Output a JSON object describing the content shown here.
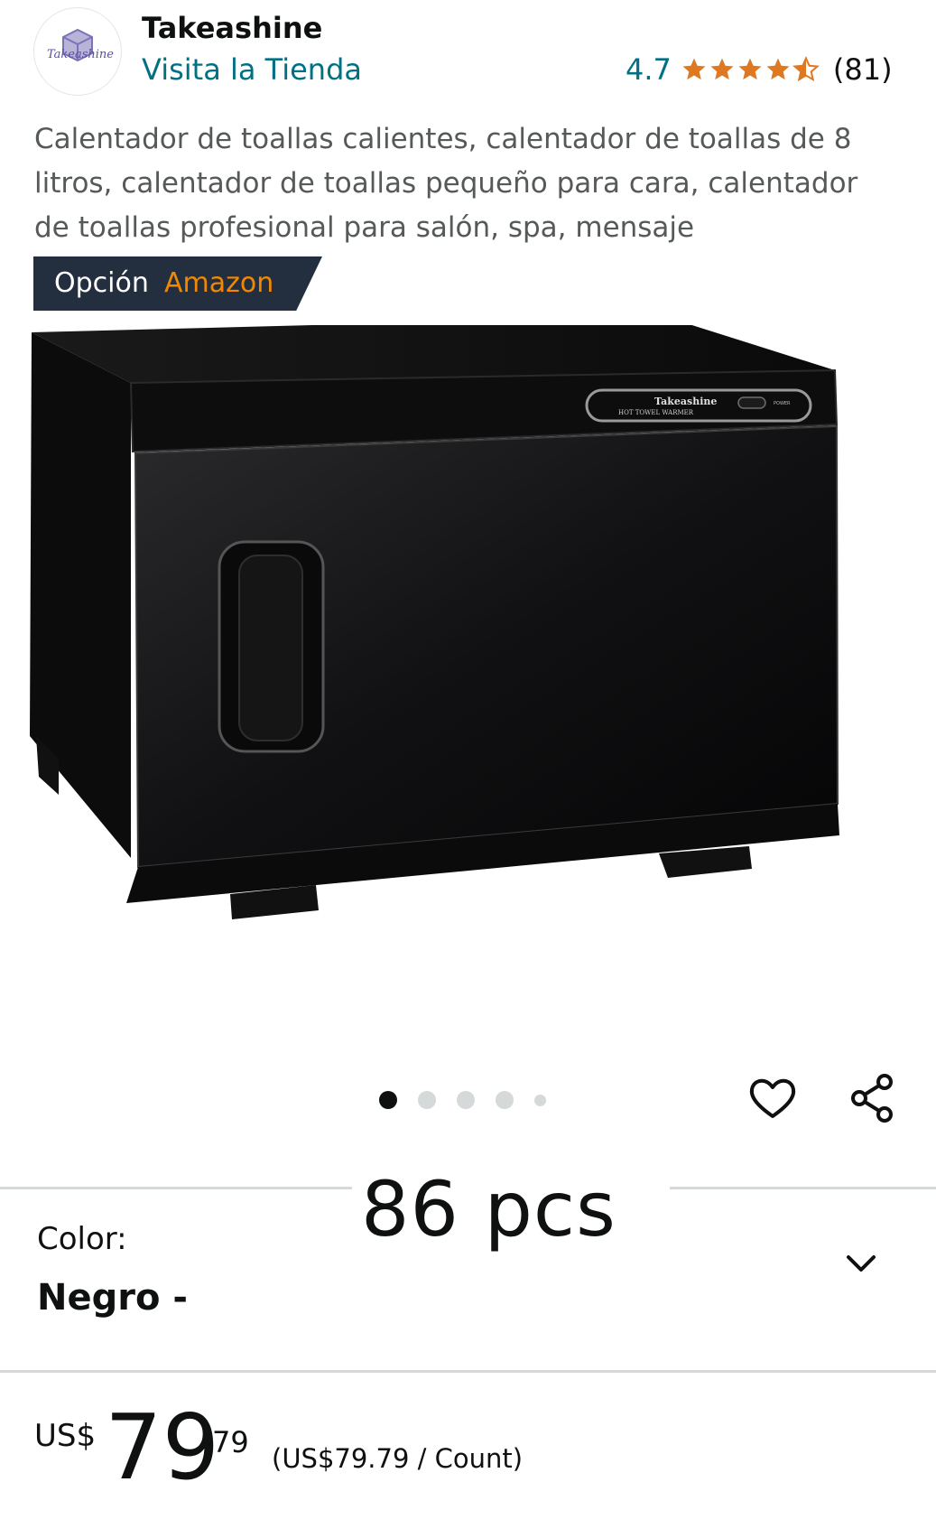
{
  "store": {
    "brand": "Takeashine",
    "logo_text": "Takeashine",
    "visit_link": "Visita la Tienda",
    "rating": "4.7",
    "stars": 4.7,
    "review_count": "(81)"
  },
  "product": {
    "title": "Calentador de toallas calientes, calentador de toallas de 8 litros, calentador de toallas pequeño para cara, calentador de toallas profesional para salón, spa, mensaje",
    "badge_prefix": "Opción",
    "badge_brand": "Amazon",
    "device_brand_label": "Takeashine",
    "device_model_label": "HOT TOWEL WARMER",
    "device_power_label": "POWER"
  },
  "carousel": {
    "total": 5,
    "active": 1
  },
  "overlay_text": "86 pcs",
  "variant": {
    "label": "Color:",
    "value": "Negro -"
  },
  "price": {
    "currency": "US$",
    "whole": "79",
    "fraction": "79",
    "unit_price": "(US$79.79 / Count)"
  },
  "colors": {
    "link": "#007185",
    "star": "#de7921",
    "badge_bg": "#232f3e",
    "badge_accent": "#f08804"
  },
  "icons": {
    "wishlist": "heart-icon",
    "share": "share-icon",
    "dropdown": "chevron-down-icon"
  }
}
